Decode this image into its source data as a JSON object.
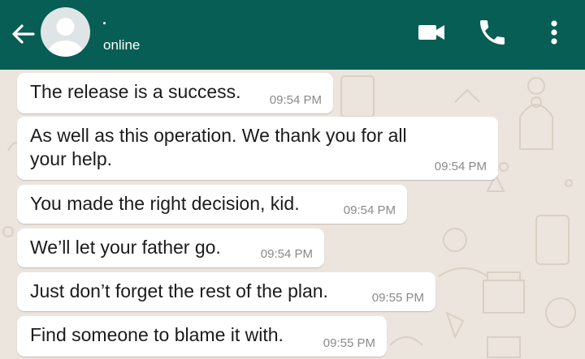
{
  "header": {
    "contact_name": "·",
    "status": "online",
    "back_icon": "arrow-left-icon",
    "video_icon": "video-call-icon",
    "call_icon": "phone-icon",
    "menu_icon": "more-vertical-icon",
    "color": "#075e54"
  },
  "messages": [
    {
      "text": "The release is a success.",
      "time": "09:54 PM"
    },
    {
      "text": "As well as this operation. We thank you for all your help.",
      "time": "09:54 PM"
    },
    {
      "text": "You made the right decision, kid.",
      "time": "09:54 PM"
    },
    {
      "text": "We’ll let your father go.",
      "time": "09:54 PM"
    },
    {
      "text": "Just don’t forget the rest of the plan.",
      "time": "09:55 PM"
    },
    {
      "text": "Find someone to blame it with.",
      "time": "09:55 PM"
    }
  ],
  "colors": {
    "bubble": "#ffffff",
    "chat_background": "#ece5dd"
  }
}
